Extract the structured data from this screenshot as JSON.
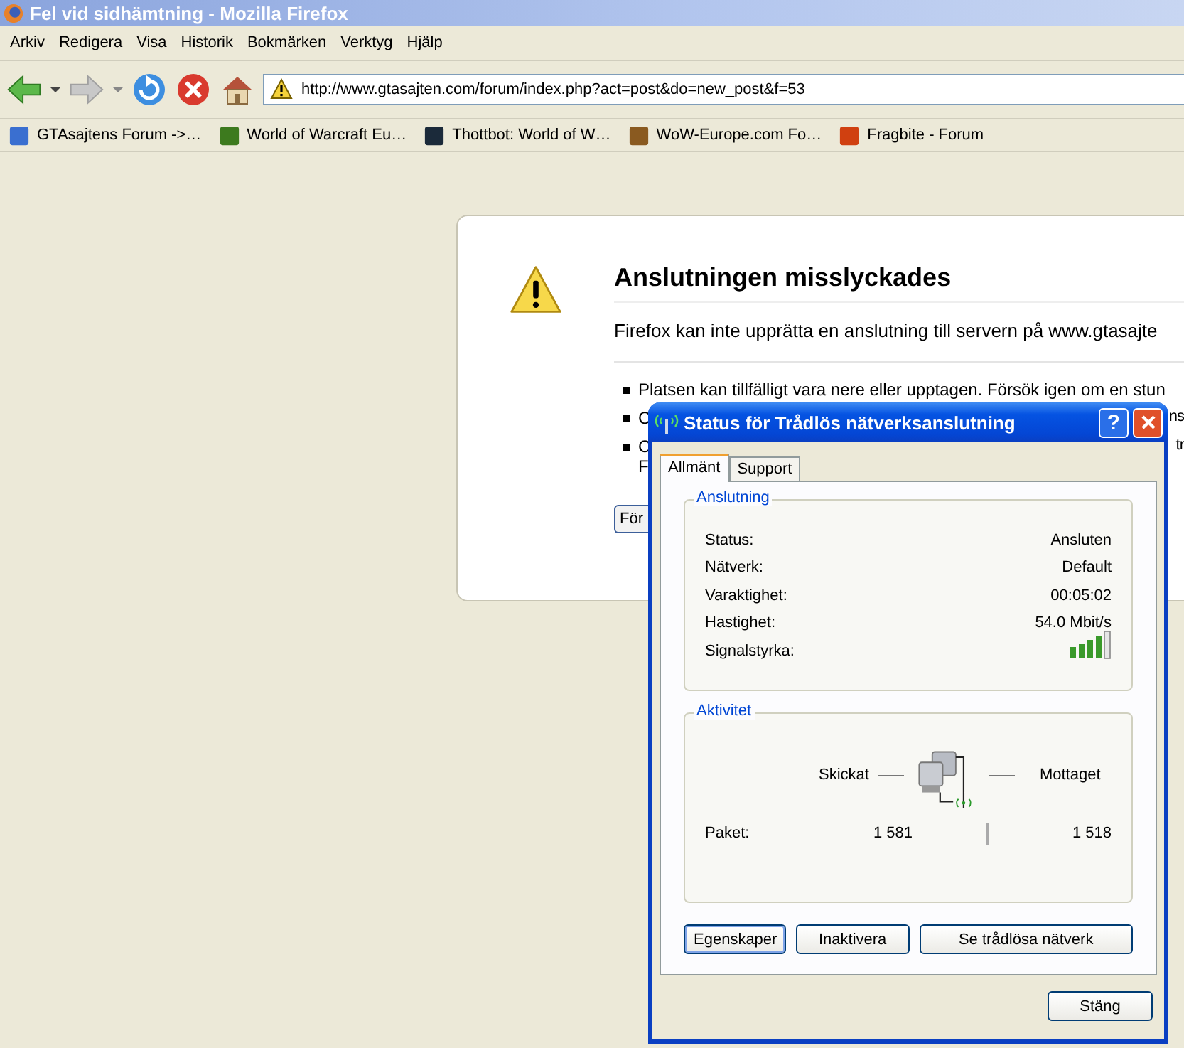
{
  "window": {
    "title": "Fel vid sidhämtning - Mozilla Firefox"
  },
  "menu": [
    "Arkiv",
    "Redigera",
    "Visa",
    "Historik",
    "Bokmärken",
    "Verktyg",
    "Hjälp"
  ],
  "address_bar": {
    "value": "http://www.gtasajten.com/forum/index.php?act=post&do=new_post&f=53"
  },
  "bookmarks": [
    {
      "label": "GTAsajtens Forum ->…",
      "color": "#3a6fd0"
    },
    {
      "label": "World of Warcraft Eu…",
      "color": "#3d7a1e"
    },
    {
      "label": "Thottbot: World of W…",
      "color": "#1b2a3a"
    },
    {
      "label": "WoW-Europe.com Fo…",
      "color": "#8a5a20"
    },
    {
      "label": "Fragbite - Forum",
      "color": "#d04010"
    }
  ],
  "error_page": {
    "title": "Anslutningen misslyckades",
    "message": "Firefox kan inte upprätta en anslutning till servern på www.gtasajte",
    "bullets": [
      {
        "lines": [
          "Platsen kan tillfälligt vara nere eller upptagen. Försök igen om en stun"
        ]
      },
      {
        "lines": [
          "C"
        ],
        "tail": "ns"
      },
      {
        "lines": [
          "C",
          "F"
        ],
        "tail": "tr"
      }
    ],
    "retry_button": "För"
  },
  "dialog": {
    "title": "Status för Trådlös nätverksanslutning",
    "help_button": "?",
    "tabs": [
      {
        "label": "Allmänt",
        "selected": true
      },
      {
        "label": "Support",
        "selected": false
      }
    ],
    "connection": {
      "title": "Anslutning",
      "rows": [
        {
          "kind": "text",
          "label": "Status:",
          "value": "Ansluten"
        },
        {
          "kind": "text",
          "label": "Nätverk:",
          "value": "Default"
        },
        {
          "kind": "text",
          "label": "Varaktighet:",
          "value": "00:05:02"
        },
        {
          "kind": "text",
          "label": "Hastighet:",
          "value": "54.0 Mbit/s"
        },
        {
          "kind": "signal",
          "label": "Signalstyrka:"
        }
      ]
    },
    "activity": {
      "title": "Aktivitet",
      "sent_label": "Skickat",
      "received_label": "Mottaget",
      "packets_label": "Paket:",
      "sent": "1 581",
      "received": "1 518"
    },
    "buttons": [
      "Egenskaper",
      "Inaktivera",
      "Se trådlösa nätverk"
    ],
    "close_button": "Stäng"
  }
}
